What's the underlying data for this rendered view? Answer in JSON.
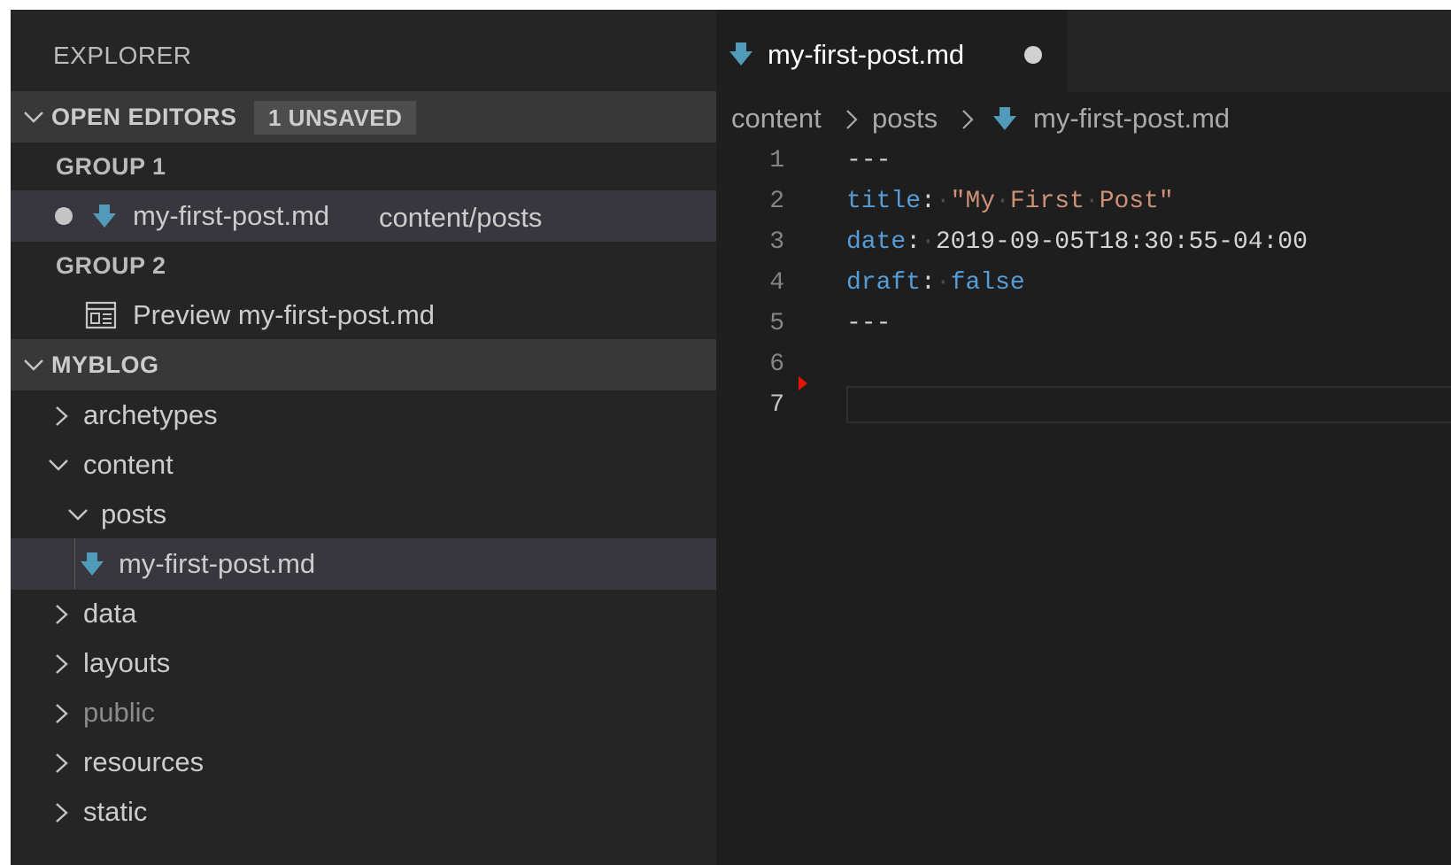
{
  "explorer": {
    "title": "EXPLORER",
    "open_editors": {
      "label": "OPEN EDITORS",
      "badge": "1 UNSAVED",
      "groups": [
        {
          "label": "GROUP 1",
          "items": [
            {
              "name": "my-first-post.md",
              "description": "content/posts",
              "unsaved": true,
              "icon": "markdown-icon"
            }
          ]
        },
        {
          "label": "GROUP 2",
          "items": [
            {
              "name": "Preview my-first-post.md",
              "icon": "preview-icon"
            }
          ]
        }
      ]
    },
    "folder": {
      "label": "MYBLOG",
      "tree": [
        {
          "name": "archetypes",
          "type": "folder",
          "expanded": false
        },
        {
          "name": "content",
          "type": "folder",
          "expanded": true
        },
        {
          "name": "posts",
          "type": "folder",
          "expanded": true
        },
        {
          "name": "my-first-post.md",
          "type": "file",
          "selected": true
        },
        {
          "name": "data",
          "type": "folder",
          "expanded": false
        },
        {
          "name": "layouts",
          "type": "folder",
          "expanded": false
        },
        {
          "name": "public",
          "type": "folder",
          "expanded": false,
          "dimmed": true
        },
        {
          "name": "resources",
          "type": "folder",
          "expanded": false
        },
        {
          "name": "static",
          "type": "folder",
          "expanded": false
        }
      ]
    }
  },
  "editor": {
    "tab": {
      "label": "my-first-post.md",
      "dirty": true
    },
    "breadcrumbs": [
      "content",
      "posts",
      "my-first-post.md"
    ],
    "lines": [
      {
        "num": "1",
        "tokens": [
          {
            "t": "---",
            "c": "p"
          }
        ]
      },
      {
        "num": "2",
        "tokens": [
          {
            "t": "title",
            "c": "k"
          },
          {
            "t": ":",
            "c": "p"
          },
          {
            "t": "·",
            "c": "ws"
          },
          {
            "t": "\"My",
            "c": "s"
          },
          {
            "t": "·",
            "c": "ws"
          },
          {
            "t": "First",
            "c": "s"
          },
          {
            "t": "·",
            "c": "ws"
          },
          {
            "t": "Post\"",
            "c": "s"
          }
        ]
      },
      {
        "num": "3",
        "tokens": [
          {
            "t": "date",
            "c": "k"
          },
          {
            "t": ":",
            "c": "p"
          },
          {
            "t": "·",
            "c": "ws"
          },
          {
            "t": "2019-09-05T18:30:55-04:00",
            "c": "v"
          }
        ]
      },
      {
        "num": "4",
        "tokens": [
          {
            "t": "draft",
            "c": "k"
          },
          {
            "t": ":",
            "c": "p"
          },
          {
            "t": "·",
            "c": "ws"
          },
          {
            "t": "false",
            "c": "b"
          }
        ]
      },
      {
        "num": "5",
        "tokens": [
          {
            "t": "---",
            "c": "p"
          }
        ]
      },
      {
        "num": "6",
        "tokens": []
      },
      {
        "num": "7",
        "tokens": [],
        "active": true
      }
    ]
  },
  "colors": {
    "markdown_icon": "#519aba",
    "error_marker": "#e51400"
  }
}
